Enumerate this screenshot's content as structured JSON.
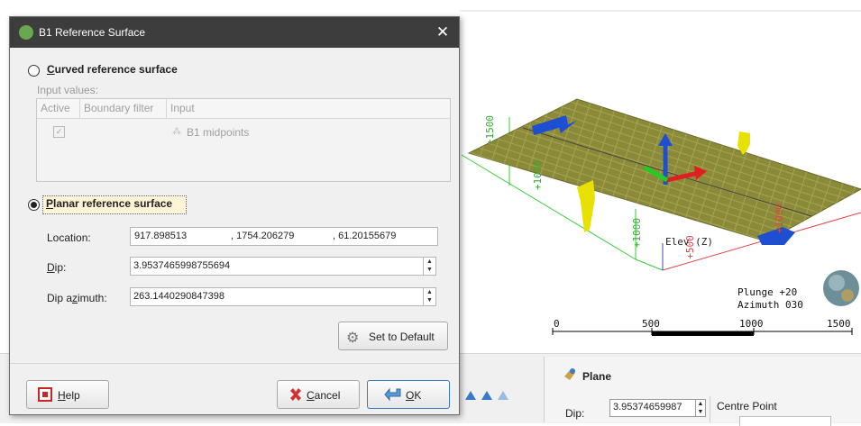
{
  "dialog": {
    "title": "B1 Reference Surface",
    "close_symbol": "✕",
    "curved": {
      "label_accel": "C",
      "label_rest": "urved reference surface",
      "selected": false,
      "input_values_label": "Input values:",
      "columns": [
        "Active",
        "Boundary filter",
        "Input"
      ],
      "row": {
        "active": true,
        "input": "B1 midpoints"
      }
    },
    "planar": {
      "label_accel": "P",
      "label_rest": "lanar reference surface",
      "selected": true
    },
    "location": {
      "label": "Location:",
      "x": "917.898513",
      "y": ", 1754.206279",
      "z": ", 61.20155679"
    },
    "dip": {
      "label_accel": "D",
      "label_rest": "ip:",
      "value": "3.9537465998755694"
    },
    "dip_azimuth": {
      "label_pre": "Dip a",
      "label_accel": "z",
      "label_rest": "imuth:",
      "value": "263.1440290847398"
    },
    "set_default_label": "Set to Default",
    "help": {
      "accel": "H",
      "rest": "elp"
    },
    "cancel": {
      "accel": "C",
      "rest": "ancel"
    },
    "ok": {
      "accel": "O",
      "rest": "K"
    }
  },
  "viewer": {
    "plunge": "Plunge +20",
    "azimuth": "Azimuth 030",
    "scale_labels": [
      "0",
      "500",
      "1000",
      "1500"
    ],
    "axis_labels": [
      "+1500",
      "+1000",
      "+1000",
      "+500",
      "+1000"
    ],
    "elev_label": "Elev (Z)"
  },
  "plane_panel": {
    "title": "Plane",
    "dip_label": "Dip:",
    "dip_value": "3.95374659987",
    "centre_point_label": "Centre Point"
  },
  "icons": [
    "reference-surface-icon",
    "gear-icon",
    "help-icon",
    "cancel-icon",
    "ok-icon",
    "plane-icon"
  ]
}
